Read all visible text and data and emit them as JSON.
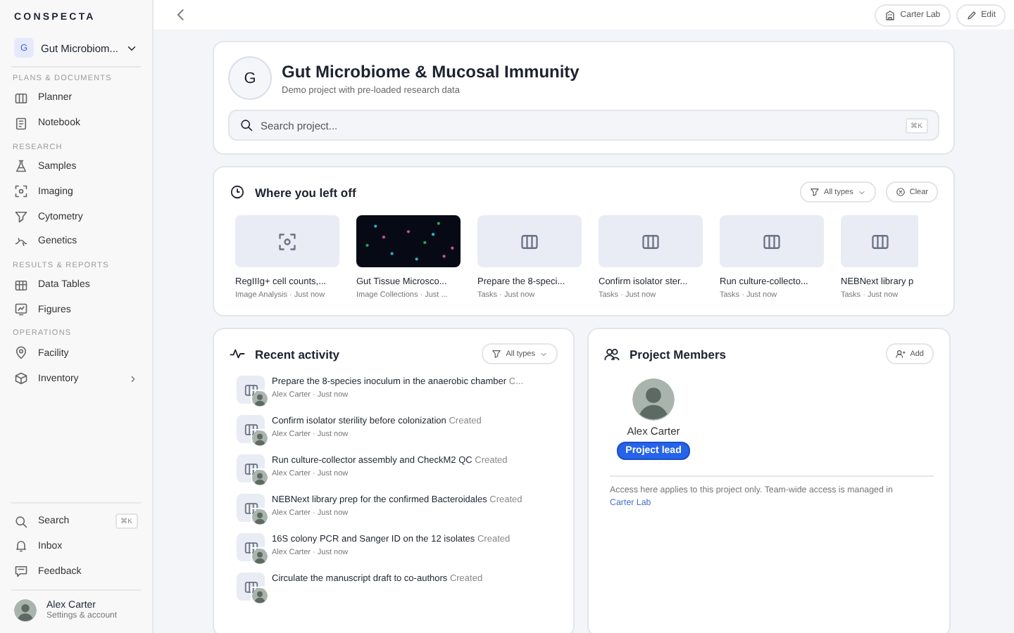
{
  "sidebar": {
    "brand": "CONSPECTA",
    "project": {
      "initial": "G",
      "name": "Gut Microbiom..."
    },
    "sections": [
      {
        "title": "PLANS & DOCUMENTS",
        "items": [
          {
            "label": "Planner",
            "expandable": false
          },
          {
            "label": "Notebook",
            "expandable": false
          }
        ]
      },
      {
        "title": "RESEARCH",
        "items": [
          {
            "label": "Samples",
            "expandable": false
          },
          {
            "label": "Imaging",
            "expandable": false
          },
          {
            "label": "Cytometry",
            "expandable": false
          },
          {
            "label": "Genetics",
            "expandable": false
          }
        ]
      },
      {
        "title": "RESULTS & REPORTS",
        "items": [
          {
            "label": "Data Tables",
            "expandable": false
          },
          {
            "label": "Figures",
            "expandable": false
          }
        ]
      },
      {
        "title": "OPERATIONS",
        "items": [
          {
            "label": "Facility",
            "expandable": false
          },
          {
            "label": "Inventory",
            "expandable": true
          }
        ]
      }
    ],
    "bottom": [
      {
        "label": "Search",
        "shortcut": "⌘K"
      },
      {
        "label": "Inbox"
      },
      {
        "label": "Feedback"
      }
    ],
    "user": {
      "name": "Alex Carter",
      "subtitle": "Settings & account"
    }
  },
  "topbar": {
    "buttons": [
      "Carter Lab",
      "Edit"
    ]
  },
  "project": {
    "initial": "G",
    "title": "Gut Microbiome & Mucosal Immunity",
    "subtitle": "Demo project with pre-loaded research data",
    "search": {
      "placeholder": "Search project...",
      "shortcut": "⌘K"
    }
  },
  "left_off": {
    "title": "Where you left off",
    "filter": "All types",
    "clear": "Clear",
    "items": [
      {
        "kind": "analysis",
        "title": "RegIIIg+ cell counts,...",
        "meta": "Image Analysis · Just now"
      },
      {
        "kind": "picture",
        "title": "Gut Tissue Microsco...",
        "meta": "Image Collections · Just ..."
      },
      {
        "kind": "task",
        "title": "Prepare the 8-speci...",
        "meta": "Tasks · Just now"
      },
      {
        "kind": "task",
        "title": "Confirm isolator ster...",
        "meta": "Tasks · Just now"
      },
      {
        "kind": "task",
        "title": "Run culture-collecto...",
        "meta": "Tasks · Just now"
      },
      {
        "kind": "task",
        "title": "NEBNext library p",
        "meta": "Tasks · Just now"
      }
    ]
  },
  "activity": {
    "title": "Recent activity",
    "filter": "All types",
    "items": [
      {
        "title": "Prepare the 8-species inoculum in the anaerobic chamber",
        "status": "C...",
        "meta": "Alex Carter · Just now"
      },
      {
        "title": "Confirm isolator sterility before colonization",
        "status": "Created",
        "meta": "Alex Carter · Just now"
      },
      {
        "title": "Run culture-collector assembly and CheckM2 QC",
        "status": "Created",
        "meta": "Alex Carter · Just now"
      },
      {
        "title": "NEBNext library prep for the confirmed Bacteroidales",
        "status": "Created",
        "meta": "Alex Carter · Just now"
      },
      {
        "title": "16S colony PCR and Sanger ID on the 12 isolates",
        "status": "Created",
        "meta": "Alex Carter · Just now"
      },
      {
        "title": "Circulate the manuscript draft to co-authors",
        "status": "Created"
      }
    ]
  },
  "members": {
    "title": "Project Members",
    "add": "Add",
    "people": [
      {
        "name": "Alex Carter",
        "role": "Project lead"
      }
    ],
    "note": "Access here applies to this project only. Team-wide access is managed in",
    "note_link": "Carter Lab"
  }
}
